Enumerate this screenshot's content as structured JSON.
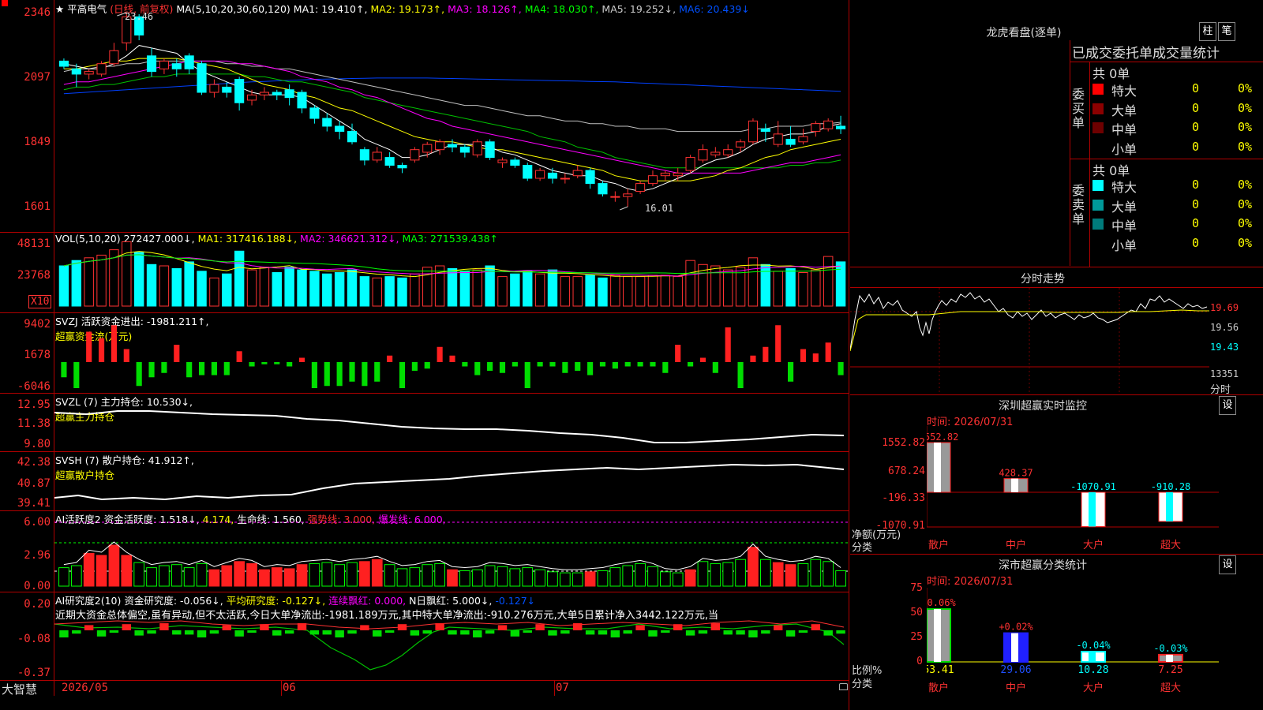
{
  "stock": {
    "marker": "★",
    "name": "平高电气",
    "period": "(日线, 前复权)"
  },
  "ma_header": {
    "label": "MA(5,10,20,30,60,120)",
    "ma1": "MA1: 19.410↑,",
    "ma2": "MA2: 19.173↑,",
    "ma3": "MA3: 18.126↑,",
    "ma4": "MA4: 18.030↑,",
    "ma5": "MA5: 19.252↓,",
    "ma6": "MA6: 20.439↓"
  },
  "price_axis": [
    "2346",
    "2097",
    "1849",
    "1601"
  ],
  "price_annotations": {
    "high": "23.46",
    "low": "16.01"
  },
  "vol_header": {
    "label": "VOL(5,10,20)",
    "value": "272427.000↓,",
    "ma1": "MA1: 317416.188↓,",
    "ma2": "MA2: 346621.312↓,",
    "ma3": "MA3: 271539.438↑"
  },
  "vol_axis": [
    "48131",
    "23768"
  ],
  "vol_unit": "X10",
  "svzj_header": {
    "label": "SVZJ 活跃资金进出: -1981.211↑,",
    "sub": "超赢资金流(万元)"
  },
  "svzj_axis": [
    "9402",
    "1678",
    "-6046"
  ],
  "svzl_header": {
    "label": "SVZL (7) 主力持仓: 10.530↓,",
    "sub": "超赢主力持仓"
  },
  "svzl_axis": [
    "12.95",
    "11.38",
    "9.80"
  ],
  "svsh_header": {
    "label": "SVSH (7) 散户持仓: 41.912↑,",
    "sub": "超赢散户持仓"
  },
  "svsh_axis": [
    "42.38",
    "40.87",
    "39.41"
  ],
  "ai_active_header": {
    "label": "AI活跃度2 资金活跃度: 1.518↓,",
    "v2": "4.174,",
    "life": "生命线: 1.560,",
    "strong": "强势线: 3.000,",
    "burst": "爆发线: 6.000,"
  },
  "ai_active_axis": [
    "6.00",
    "2.96",
    "0.00"
  ],
  "ai_research_header": {
    "label": "AI研究度2(10) 资金研究度: -0.056↓,",
    "avg": "平均研究度: -0.127↓,",
    "red": "连续飘红: 0.000,",
    "nred": "N日飘红: 5.000↓,",
    "last": "-0.127↓"
  },
  "ai_research_text": "近期大资金总体偏空,虽有异动,但不太活跃,今日大单净流出:-1981.189万元,其中特大单净流出:-910.276万元,大单5日累计净入3442.122万元,当",
  "ai_research_axis": [
    "0.20",
    "-0.08",
    "-0.37"
  ],
  "date_axis": {
    "brand": "大智慧",
    "d1": "2026/05",
    "d2": "06",
    "d3": "07"
  },
  "right_panel": {
    "dragon_title": "龙虎看盘(逐单)",
    "btn1": "柱",
    "btn2": "笔",
    "tabs_title": "已成交委托单成交量统计",
    "buy_label": "委买单",
    "sell_label": "委卖单",
    "buy_total": "共 0单",
    "sell_total": "共 0单",
    "buy_rows": [
      {
        "name": "特大",
        "count": "0",
        "pct": "0%",
        "color": "#ff0000"
      },
      {
        "name": "大单",
        "count": "0",
        "pct": "0%",
        "color": "#8b0000"
      },
      {
        "name": "中单",
        "count": "0",
        "pct": "0%",
        "color": "#6e0000"
      },
      {
        "name": "小单",
        "count": "0",
        "pct": "0%",
        "color": ""
      }
    ],
    "sell_rows": [
      {
        "name": "特大",
        "count": "0",
        "pct": "0%",
        "color": "#00ffff"
      },
      {
        "name": "大单",
        "count": "0",
        "pct": "0%",
        "color": "#009999"
      },
      {
        "name": "中单",
        "count": "0",
        "pct": "0%",
        "color": "#007b7b"
      },
      {
        "name": "小单",
        "count": "0",
        "pct": "0%",
        "color": ""
      }
    ],
    "intraday_title": "分时走势",
    "intraday_axis": [
      "19.69",
      "19.56",
      "19.43",
      "13351"
    ],
    "intraday_unit": "分时",
    "sz_monitor_title": "深圳超赢实时监控",
    "set_btn": "设",
    "monitor_time": "时间: 2026/07/31",
    "monitor_axis": [
      "1552.82",
      "678.24",
      "-196.33",
      "-1070.91"
    ],
    "monitor_axis_label": "净额(万元)",
    "category_label": "分类",
    "monitor_values": [
      "1552.82",
      "428.37",
      "-1070.91",
      "-910.28"
    ],
    "categories": [
      "散户",
      "中户",
      "大户",
      "超大"
    ],
    "class_title": "深市超赢分类统计",
    "class_time": "时间: 2026/07/31",
    "class_axis": [
      "75",
      "50",
      "25",
      "0"
    ],
    "class_axis_label": "比例%",
    "class_changes": [
      "+0.06%",
      "+0.02%",
      "-0.04%",
      "-0.03%"
    ],
    "class_values": [
      "53.41",
      "29.06",
      "10.28",
      "7.25"
    ]
  },
  "chart_data": [
    {
      "type": "candlestick",
      "title": "平高电气",
      "ohlc": [
        [
          21.6,
          21.4,
          21.7,
          21.3
        ],
        [
          21.3,
          21.1,
          21.5,
          20.6
        ],
        [
          21.1,
          21.2,
          21.3,
          20.9
        ],
        [
          21.1,
          21.5,
          21.6,
          21.0
        ],
        [
          21.5,
          22.0,
          22.3,
          21.4
        ],
        [
          22.3,
          23.3,
          23.46,
          22.0
        ],
        [
          23.3,
          22.6,
          23.4,
          22.4
        ],
        [
          21.8,
          21.2,
          22.1,
          21.0
        ],
        [
          21.3,
          21.6,
          21.7,
          21.1
        ],
        [
          21.5,
          21.3,
          21.7,
          21.0
        ],
        [
          21.8,
          21.3,
          21.9,
          21.1
        ],
        [
          21.5,
          20.4,
          21.6,
          20.3
        ],
        [
          20.4,
          20.7,
          20.9,
          20.2
        ],
        [
          20.6,
          20.4,
          20.8,
          20.2
        ],
        [
          20.9,
          20.0,
          21.0,
          19.7
        ],
        [
          20.1,
          20.3,
          20.5,
          19.9
        ],
        [
          20.3,
          20.4,
          20.6,
          20.1
        ],
        [
          20.4,
          20.3,
          20.5,
          20.1
        ],
        [
          20.5,
          20.2,
          20.7,
          19.9
        ],
        [
          20.4,
          19.8,
          20.5,
          19.6
        ],
        [
          19.8,
          19.4,
          19.9,
          19.2
        ],
        [
          19.4,
          19.1,
          19.6,
          18.9
        ],
        [
          19.1,
          18.9,
          19.3,
          18.6
        ],
        [
          18.9,
          18.5,
          19.2,
          18.4
        ],
        [
          18.2,
          17.8,
          18.3,
          17.6
        ],
        [
          17.8,
          18.1,
          18.3,
          17.7
        ],
        [
          17.9,
          17.6,
          18.1,
          17.5
        ],
        [
          17.6,
          17.5,
          17.7,
          17.3
        ],
        [
          17.8,
          18.2,
          18.3,
          17.7
        ],
        [
          18.1,
          18.4,
          18.5,
          17.9
        ],
        [
          18.2,
          18.5,
          18.6,
          18.0
        ],
        [
          18.4,
          18.3,
          18.6,
          18.1
        ],
        [
          18.3,
          18.1,
          18.4,
          17.9
        ],
        [
          18.0,
          18.5,
          18.6,
          17.9
        ],
        [
          18.5,
          17.9,
          18.6,
          17.8
        ],
        [
          17.7,
          17.8,
          17.9,
          17.5
        ],
        [
          17.8,
          17.6,
          17.9,
          17.5
        ],
        [
          17.6,
          17.1,
          17.7,
          17.0
        ],
        [
          17.1,
          17.4,
          17.5,
          17.0
        ],
        [
          17.3,
          17.1,
          17.5,
          16.9
        ],
        [
          17.1,
          17.1,
          17.3,
          16.9
        ],
        [
          17.2,
          17.4,
          17.6,
          17.1
        ],
        [
          17.4,
          16.9,
          17.5,
          16.7
        ],
        [
          16.9,
          16.5,
          17.0,
          16.4
        ],
        [
          16.4,
          16.4,
          16.6,
          16.2
        ],
        [
          16.4,
          16.5,
          16.7,
          16.01
        ],
        [
          16.6,
          16.9,
          17.0,
          16.5
        ],
        [
          16.9,
          17.2,
          17.4,
          16.8
        ],
        [
          17.2,
          17.3,
          17.4,
          17.0
        ],
        [
          17.2,
          17.3,
          17.5,
          17.0
        ],
        [
          17.4,
          17.9,
          18.0,
          17.3
        ],
        [
          17.8,
          18.2,
          18.4,
          17.7
        ],
        [
          18.0,
          18.1,
          18.3,
          17.9
        ],
        [
          18.0,
          18.2,
          18.4,
          17.9
        ],
        [
          18.3,
          18.5,
          18.6,
          18.1
        ],
        [
          18.5,
          19.3,
          19.4,
          18.4
        ],
        [
          19.0,
          18.9,
          19.2,
          18.5
        ],
        [
          18.4,
          18.8,
          19.3,
          18.3
        ],
        [
          18.6,
          18.4,
          19.1,
          18.3
        ],
        [
          18.5,
          18.7,
          19.0,
          18.4
        ],
        [
          18.9,
          19.2,
          19.3,
          18.7
        ],
        [
          19.0,
          19.3,
          19.4,
          18.9
        ],
        [
          19.1,
          19.0,
          19.5,
          18.8
        ]
      ],
      "ma1": [
        21.5,
        21.4,
        21.3,
        21.3,
        21.5,
        21.8,
        22.2,
        22.1,
        22.0,
        21.9,
        21.5,
        21.2,
        21.0,
        20.8,
        20.6,
        20.4,
        20.3,
        20.3,
        20.3,
        20.2,
        19.9,
        19.6,
        19.3,
        19.0,
        18.6,
        18.4,
        18.2,
        17.9,
        17.9,
        18.0,
        18.2,
        18.4,
        18.4,
        18.4,
        18.3,
        18.1,
        18.0,
        17.8,
        17.6,
        17.4,
        17.3,
        17.2,
        17.2,
        17.0,
        16.9,
        16.7,
        16.6,
        16.7,
        16.9,
        17.1,
        17.3,
        17.6,
        17.8,
        17.9,
        18.1,
        18.4,
        18.6,
        18.7,
        18.8,
        18.8,
        18.9,
        19.1,
        19.2
      ],
      "ma2": [
        21.3,
        21.3,
        21.4,
        21.5,
        21.6,
        21.6,
        21.7,
        21.7,
        21.7,
        21.7,
        21.6,
        21.5,
        21.4,
        21.3,
        21.1,
        20.9,
        20.7,
        20.6,
        20.5,
        20.3,
        20.2,
        20.0,
        19.8,
        19.7,
        19.5,
        19.3,
        19.1,
        18.9,
        18.7,
        18.6,
        18.5,
        18.5,
        18.4,
        18.3,
        18.2,
        18.2,
        18.1,
        18.0,
        17.9,
        17.8,
        17.7,
        17.6,
        17.5,
        17.4,
        17.2,
        17.1,
        17.0,
        17.0,
        17.0,
        17.0,
        17.0,
        17.1,
        17.2,
        17.4,
        17.5,
        17.7,
        17.9,
        18.0,
        18.2,
        18.3,
        18.4,
        18.5,
        18.6
      ],
      "ma3": [
        20.7,
        20.8,
        20.8,
        20.9,
        21.0,
        21.1,
        21.2,
        21.3,
        21.4,
        21.5,
        21.6,
        21.6,
        21.6,
        21.6,
        21.5,
        21.5,
        21.4,
        21.3,
        21.2,
        21.0,
        20.9,
        20.8,
        20.6,
        20.5,
        20.3,
        20.2,
        20.0,
        19.8,
        19.6,
        19.4,
        19.3,
        19.1,
        19.0,
        18.9,
        18.8,
        18.7,
        18.6,
        18.5,
        18.4,
        18.3,
        18.2,
        18.1,
        18.0,
        17.9,
        17.8,
        17.7,
        17.6,
        17.5,
        17.4,
        17.3,
        17.3,
        17.3,
        17.3,
        17.3,
        17.3,
        17.4,
        17.5,
        17.6,
        17.7,
        17.7,
        17.8,
        17.9,
        18.0
      ],
      "ma4": [
        20.5,
        20.6,
        20.6,
        20.7,
        20.7,
        20.8,
        20.9,
        21.0,
        21.0,
        21.1,
        21.1,
        21.1,
        21.1,
        21.1,
        21.1,
        21.0,
        21.0,
        20.9,
        20.8,
        20.8,
        20.7,
        20.6,
        20.5,
        20.4,
        20.2,
        20.1,
        20.0,
        19.9,
        19.8,
        19.7,
        19.6,
        19.5,
        19.4,
        19.3,
        19.2,
        19.1,
        19.0,
        18.9,
        18.7,
        18.6,
        18.5,
        18.3,
        18.2,
        18.1,
        17.9,
        17.8,
        17.7,
        17.6,
        17.5,
        17.5,
        17.5,
        17.5,
        17.5,
        17.5,
        17.5,
        17.5,
        17.5,
        17.5,
        17.6,
        17.6,
        17.7,
        17.7,
        17.8
      ],
      "ma5": [
        21.2,
        21.3,
        21.3,
        21.4,
        21.4,
        21.5,
        21.5,
        21.6,
        21.6,
        21.6,
        21.6,
        21.6,
        21.6,
        21.5,
        21.5,
        21.4,
        21.4,
        21.3,
        21.3,
        21.2,
        21.1,
        21.0,
        20.9,
        20.8,
        20.7,
        20.6,
        20.5,
        20.4,
        20.3,
        20.2,
        20.1,
        20.0,
        19.9,
        19.9,
        19.8,
        19.7,
        19.6,
        19.5,
        19.5,
        19.4,
        19.3,
        19.3,
        19.2,
        19.2,
        19.1,
        19.1,
        19.0,
        19.0,
        19.0,
        18.9,
        18.9,
        18.9,
        18.9,
        18.9,
        18.9,
        19.0,
        19.0,
        19.1,
        19.1,
        19.1,
        19.2,
        19.2,
        19.25
      ],
      "ma6": [
        20.35,
        20.38,
        20.41,
        20.44,
        20.47,
        20.5,
        20.53,
        20.56,
        20.59,
        20.62,
        20.65,
        20.68,
        20.71,
        20.74,
        20.77,
        20.8,
        20.82,
        20.84,
        20.86,
        20.88,
        20.9,
        20.91,
        20.92,
        20.93,
        20.94,
        20.95,
        20.95,
        20.95,
        20.95,
        20.95,
        20.94,
        20.93,
        20.92,
        20.91,
        20.9,
        20.89,
        20.88,
        20.87,
        20.86,
        20.85,
        20.84,
        20.83,
        20.82,
        20.81,
        20.8,
        20.78,
        20.76,
        20.74,
        20.72,
        20.7,
        20.68,
        20.66,
        20.64,
        20.62,
        20.6,
        20.58,
        20.56,
        20.54,
        20.52,
        20.5,
        20.48,
        20.46,
        20.44
      ]
    },
    {
      "type": "bar",
      "title": "VOL",
      "values": [
        30,
        34,
        36,
        38,
        42,
        48,
        40,
        31,
        30,
        28,
        33,
        26,
        21,
        24,
        41,
        27,
        29,
        25,
        29,
        27,
        26,
        24,
        25,
        27,
        22,
        21,
        22,
        21,
        24,
        29,
        30,
        28,
        26,
        27,
        30,
        22,
        24,
        26,
        24,
        27,
        22,
        22,
        23,
        21,
        23,
        22,
        22,
        23,
        23,
        22,
        34,
        31,
        30,
        27,
        29,
        36,
        31,
        26,
        28,
        25,
        27,
        37,
        33
      ]
    },
    {
      "type": "bar",
      "title": "SVZJ",
      "values": [
        -3.5,
        -6.0,
        7.0,
        5.5,
        8.5,
        3.0,
        -5.5,
        -3.5,
        -2.5,
        4.0,
        -3.5,
        -3.0,
        -3.0,
        -3.0,
        2.5,
        -1.0,
        -0.5,
        -0.5,
        -1.0,
        1.0,
        -6.0,
        -5.5,
        -5.5,
        -4.5,
        -5.5,
        -4.5,
        1.5,
        -6.0,
        -2.0,
        -1.5,
        3.5,
        1.5,
        -1.0,
        -3.0,
        -2.0,
        -2.5,
        -1.0,
        -6.0,
        -1.0,
        -1.0,
        -2.5,
        -2.0,
        -3.0,
        -1.0,
        -1.5,
        -1.0,
        -1.0,
        -1.0,
        -2.5,
        4.0,
        -1.0,
        1.0,
        -2.5,
        8.0,
        -6.0,
        1.5,
        3.5,
        8.5,
        -4.5,
        3.0,
        2.0,
        4.5,
        -3.0
      ]
    }
  ]
}
